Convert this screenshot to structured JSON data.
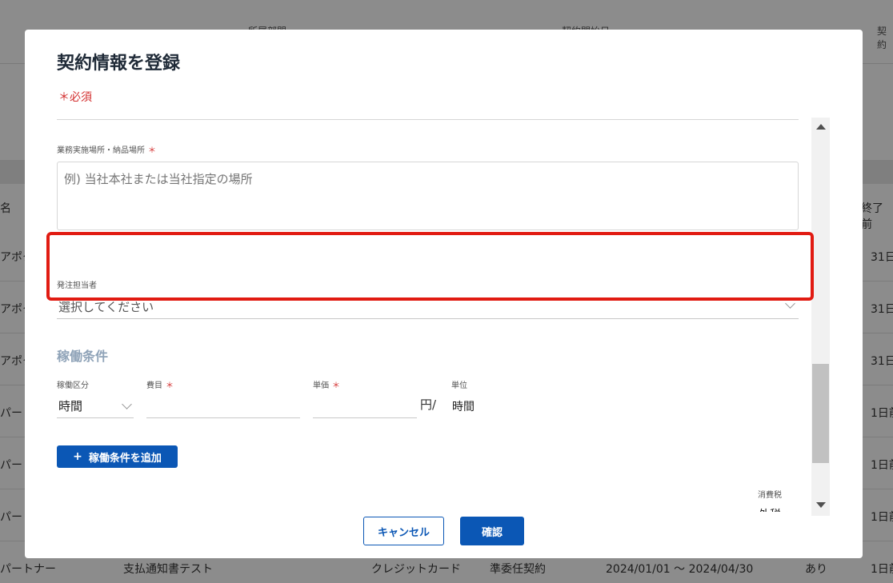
{
  "background": {
    "headers": [
      "所属部門",
      "契約開始日",
      "契約"
    ],
    "columns": [
      "名",
      "終了前"
    ],
    "rows": [
      {
        "name": "アポタ",
        "notice": "31日"
      },
      {
        "name": "アポタ",
        "notice": "31日"
      },
      {
        "name": "アポタ",
        "notice": "31日"
      },
      {
        "name": "パート",
        "notice": "1日前"
      },
      {
        "name": "パート",
        "notice": "1日前"
      },
      {
        "name": "パート",
        "notice": "1日前"
      }
    ],
    "last_row": {
      "name": "パートナー",
      "title": "支払通知書テスト",
      "payment": "クレジットカード",
      "contract_type": "準委任契約",
      "period": "2024/01/01 〜 2024/04/30",
      "flag": "あり",
      "notice": "1日前"
    }
  },
  "modal": {
    "title": "契約情報を登録",
    "required_note": "＊必須",
    "workplace": {
      "label": "業務実施場所・納品場所",
      "required_mark": "＊",
      "placeholder": "例) 当社本社または当社指定の場所"
    },
    "orderer": {
      "label": "発注担当者",
      "placeholder": "選択してください"
    },
    "work_conditions": {
      "title": "稼働条件",
      "category_label": "稼働区分",
      "category_value": "時間",
      "expense_label": "費目",
      "expense_required": "＊",
      "expense_value": "",
      "unit_price_label": "単価",
      "unit_price_required": "＊",
      "unit_price_value": "",
      "unit_price_suffix": "円/",
      "unit_label": "単位",
      "unit_value": "時間"
    },
    "add_condition_button": "稼働条件を追加",
    "add_icon": "plus-icon",
    "tax": {
      "label": "消費税",
      "value": "外税"
    },
    "cancel_button": "キャンセル",
    "confirm_button": "確認"
  },
  "colors": {
    "primary": "#0b57b5",
    "required": "#d32f2f",
    "highlight": "#e11b12",
    "section_title": "#8fa3b8"
  }
}
